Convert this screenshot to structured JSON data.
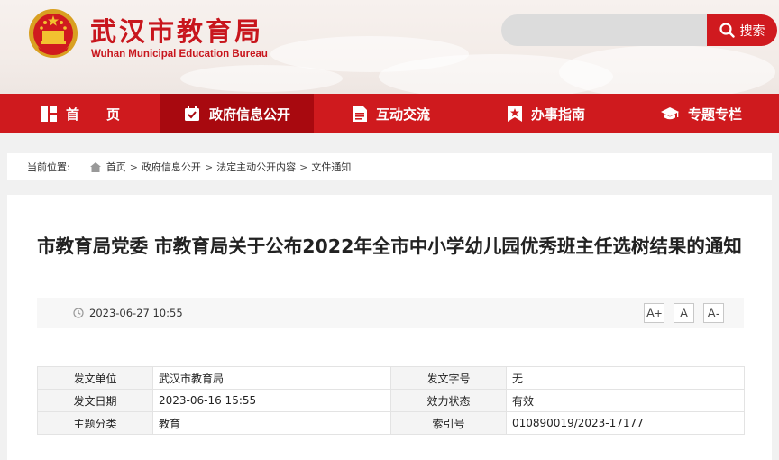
{
  "header": {
    "site_title": "武汉市教育局",
    "site_subtitle": "Wuhan Municipal Education Bureau",
    "logo_icon": "national-emblem-icon",
    "search": {
      "placeholder": "",
      "button_label": "搜索"
    }
  },
  "nav": {
    "items": [
      {
        "label": "首　　页",
        "icon": "home-grid-icon"
      },
      {
        "label": "政府信息公开",
        "icon": "calendar-check-icon"
      },
      {
        "label": "互动交流",
        "icon": "document-icon"
      },
      {
        "label": "办事指南",
        "icon": "bookmark-star-icon"
      },
      {
        "label": "专题专栏",
        "icon": "graduation-cap-icon"
      }
    ]
  },
  "breadcrumb": {
    "label": "当前位置:",
    "items": [
      "首页",
      "政府信息公开",
      "法定主动公开内容",
      "文件通知"
    ]
  },
  "article": {
    "title": "市教育局党委 市教育局关于公布2022年全市中小学幼儿园优秀班主任选树结果的通知",
    "date": "2023-06-27 10:55",
    "font_buttons": [
      "A+",
      "A",
      "A-"
    ]
  },
  "info_table": [
    {
      "k1": "发文单位",
      "v1": "武汉市教育局",
      "k2": "发文字号",
      "v2": "无"
    },
    {
      "k1": "发文日期",
      "v1": "2023-06-16 15:55",
      "k2": "效力状态",
      "v2": "有效"
    },
    {
      "k1": "主题分类",
      "v1": "教育",
      "k2": "索引号",
      "v2": "010890019/2023-17177"
    }
  ],
  "colors": {
    "brand_red": "#cf1a1e",
    "active_nav": "#a8090f"
  }
}
